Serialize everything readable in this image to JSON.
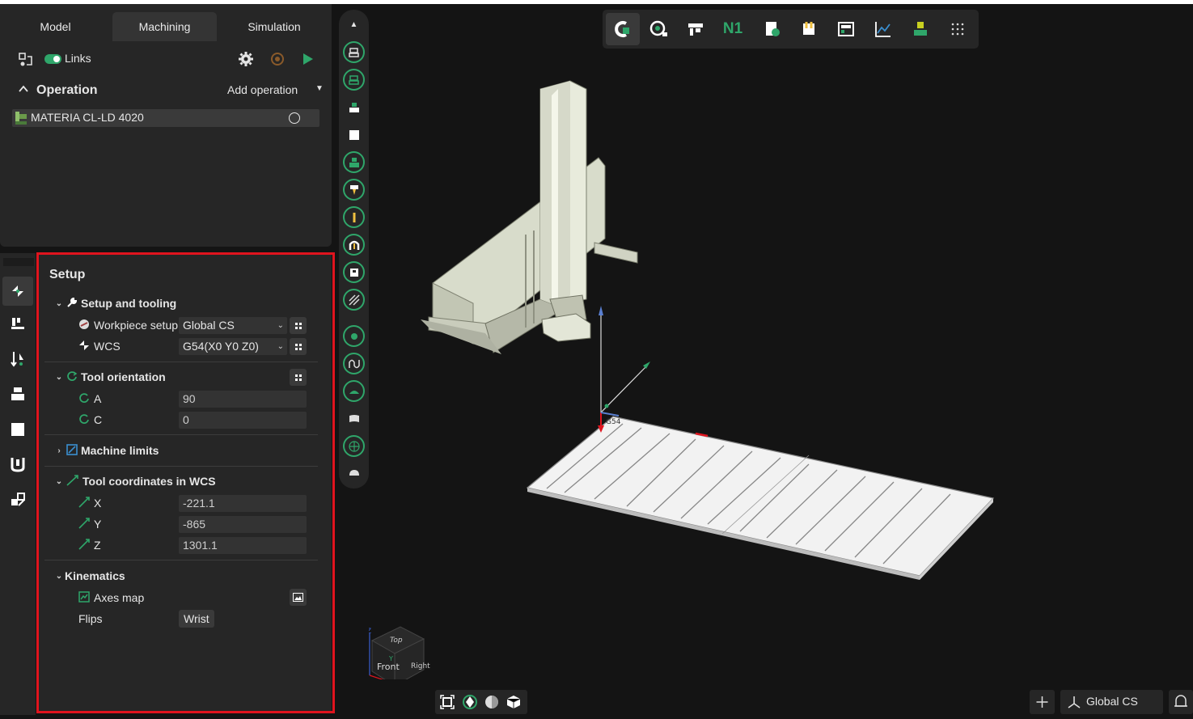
{
  "tabs": [
    {
      "label": "Model"
    },
    {
      "label": "Machining"
    },
    {
      "label": "Simulation"
    }
  ],
  "toolbar": {
    "links_label": "Links"
  },
  "operations": {
    "header": "Operation",
    "add_label": "Add operation",
    "items": [
      {
        "label": "MATERIA CL-LD 4020"
      }
    ]
  },
  "setup": {
    "title": "Setup",
    "setup_tooling": {
      "label": "Setup and tooling",
      "workpiece_label": "Workpiece setup",
      "workpiece_value": "Global CS",
      "wcs_label": "WCS",
      "wcs_value": "G54(X0 Y0 Z0)"
    },
    "tool_orientation": {
      "label": "Tool orientation",
      "a_label": "A",
      "a_value": "90",
      "c_label": "C",
      "c_value": "0"
    },
    "machine_limits": {
      "label": "Machine limits"
    },
    "tool_coordinates": {
      "label": "Tool coordinates in WCS",
      "x_label": "X",
      "x_value": "-221.1",
      "y_label": "Y",
      "y_value": "-865",
      "z_label": "Z",
      "z_value": "1301.1"
    },
    "kinematics": {
      "label": "Kinematics",
      "axes_map_label": "Axes map",
      "flips_label": "Flips",
      "flips_value": "Wrist"
    }
  },
  "top_toolbar": {
    "n1_label": "N1"
  },
  "viewport": {
    "origin_label": "G54",
    "cube": {
      "top": "Top",
      "front": "Front",
      "right": "Right",
      "z": "Z",
      "y": "Y",
      "x": "X"
    }
  },
  "coordinate_system": {
    "label": "Global CS"
  },
  "colors": {
    "accent": "#2fa66a",
    "highlight": "#e0141e",
    "panel": "#262626",
    "background": "#141414"
  }
}
